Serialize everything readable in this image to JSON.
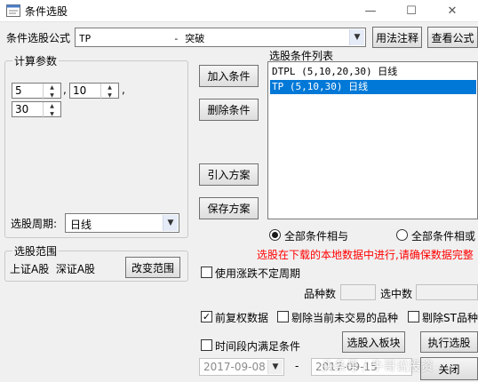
{
  "window": {
    "title": "条件选股",
    "minimize": "—",
    "maximize": "☐",
    "close": "✕"
  },
  "formula": {
    "label": "条件选股公式",
    "selected": "TP              - 突破",
    "usage_btn": "用法注释",
    "view_btn": "查看公式"
  },
  "params": {
    "legend": "计算参数",
    "values": [
      "5",
      "10",
      "30"
    ],
    "sep1": ",",
    "sep2": ","
  },
  "period": {
    "label": "选股周期:",
    "value": "日线"
  },
  "actions": {
    "add": "加入条件",
    "delete": "删除条件",
    "import": "引入方案",
    "save": "保存方案"
  },
  "conditions": {
    "label": "选股条件列表",
    "items": [
      "DTPL (5,10,20,30) 日线",
      "TP (5,10,30) 日线"
    ],
    "selected_index": 1
  },
  "logic": {
    "and_label": "全部条件相与",
    "or_label": "全部条件相或"
  },
  "scope": {
    "legend": "选股范围",
    "markets": "上证A股  深证A股",
    "change_btn": "改变范围"
  },
  "notice": "选股在下载的本地数据中进行,请确保数据完整",
  "options": {
    "use_rise_fall": "使用涨跌不定周期",
    "count_label": "品种数",
    "hit_label": "选中数",
    "fq_label": "前复权数据",
    "fq_checked": true,
    "exclude_untraded": "剔除当前未交易的品种",
    "exclude_st": "剔除ST品种",
    "period_cond": "时间段内满足条件"
  },
  "bottom": {
    "to_block_btn": "选股入板块",
    "run_btn": "执行选股",
    "close_btn": "关闭",
    "date_from": "2017-09-08",
    "date_dash": "-",
    "date_to": "2017-09-15"
  },
  "watermark": "头条号 / 牛哥说投资"
}
